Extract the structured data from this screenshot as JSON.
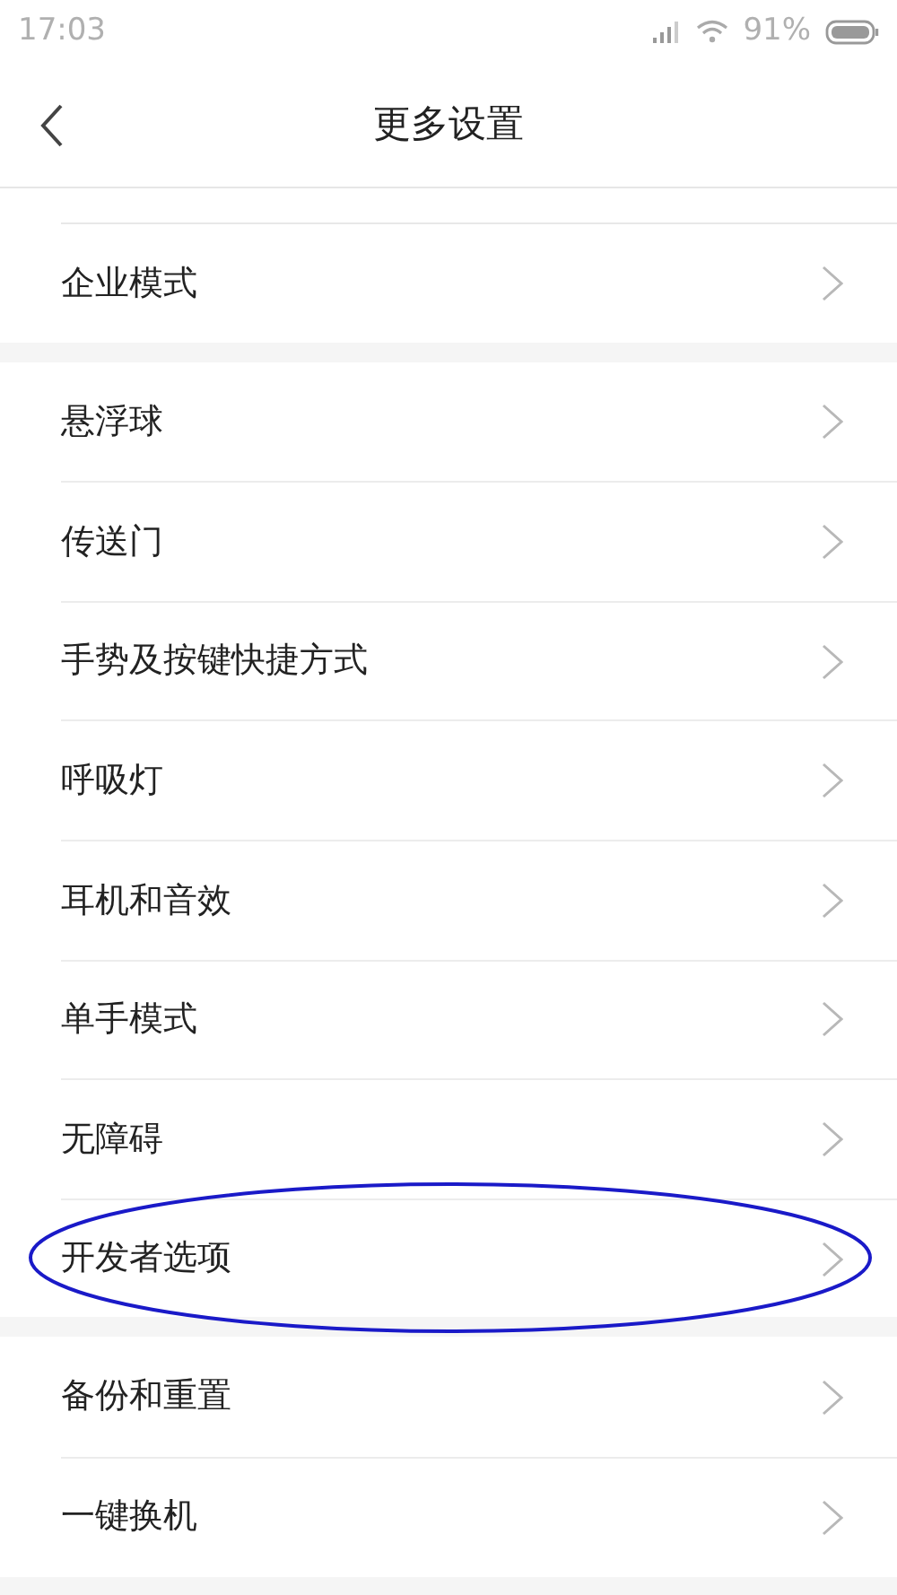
{
  "status_bar": {
    "time": "17:03",
    "battery_text": "91%"
  },
  "header": {
    "title": "更多设置"
  },
  "groups": [
    {
      "items": [
        {
          "label": "企业模式",
          "circled": false
        }
      ]
    },
    {
      "items": [
        {
          "label": "悬浮球",
          "circled": false
        },
        {
          "label": "传送门",
          "circled": false
        },
        {
          "label": "手势及按键快捷方式",
          "circled": false
        },
        {
          "label": "呼吸灯",
          "circled": false
        },
        {
          "label": "耳机和音效",
          "circled": false
        },
        {
          "label": "单手模式",
          "circled": false
        },
        {
          "label": "无障碍",
          "circled": false
        },
        {
          "label": "开发者选项",
          "circled": true
        }
      ]
    },
    {
      "items": [
        {
          "label": "备份和重置",
          "circled": false
        },
        {
          "label": "一键换机",
          "circled": false
        }
      ]
    }
  ]
}
